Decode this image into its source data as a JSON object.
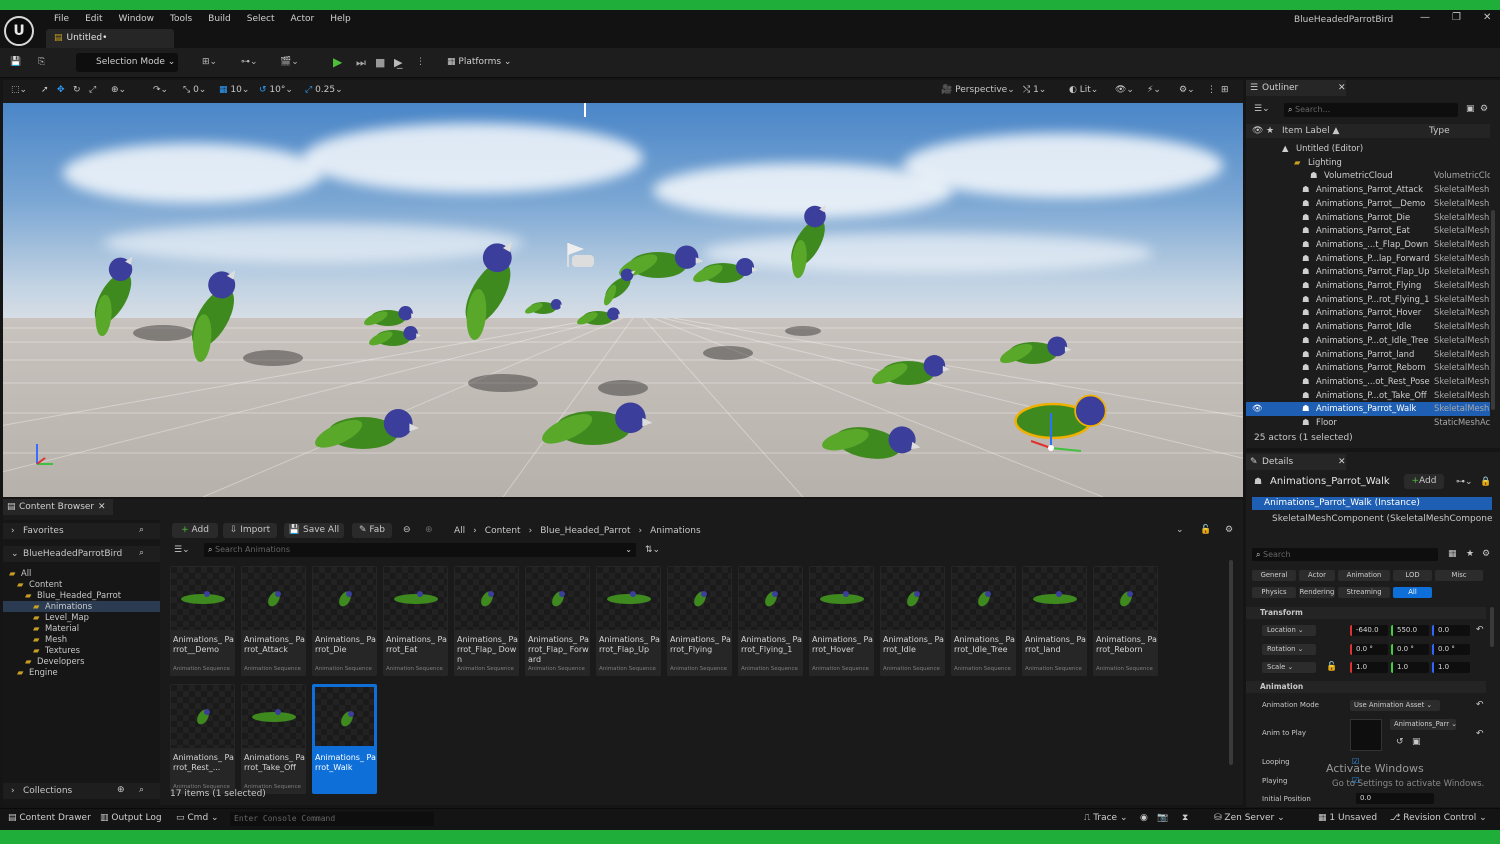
{
  "app": {
    "project_name": "BlueHeadedParrotBird",
    "doc_tab": "Untitled•",
    "logo": "U"
  },
  "menu": [
    "File",
    "Edit",
    "Window",
    "Tools",
    "Build",
    "Select",
    "Actor",
    "Help"
  ],
  "toolbar": {
    "selection_mode": "Selection Mode",
    "platforms": "Platforms"
  },
  "viewport_toolbar": {
    "grid_rot": "0",
    "snap_move": "10",
    "snap_rot": "10°",
    "snap_scale": "0.25",
    "view_mode": "Perspective",
    "view_count": "1",
    "lit": "Lit"
  },
  "outliner": {
    "title": "Outliner",
    "search_placeholder": "Search...",
    "col_label": "Item Label ▲",
    "col_type": "Type",
    "rows": [
      {
        "label": "Untitled (Editor)",
        "type": "",
        "indent": 50
      },
      {
        "label": "Lighting",
        "type": "",
        "indent": 62
      },
      {
        "label": "VolumetricCloud",
        "type": "VolumetricClo",
        "indent": 78
      },
      {
        "label": "Animations_Parrot_Attack",
        "type": "SkeletalMesh",
        "indent": 70
      },
      {
        "label": "Animations_Parrot__Demo",
        "type": "SkeletalMesh",
        "indent": 70
      },
      {
        "label": "Animations_Parrot_Die",
        "type": "SkeletalMesh",
        "indent": 70
      },
      {
        "label": "Animations_Parrot_Eat",
        "type": "SkeletalMesh",
        "indent": 70
      },
      {
        "label": "Animations_...t_Flap_Down",
        "type": "SkeletalMesh",
        "indent": 70
      },
      {
        "label": "Animations_P...lap_Forward",
        "type": "SkeletalMesh",
        "indent": 70
      },
      {
        "label": "Animations_Parrot_Flap_Up",
        "type": "SkeletalMesh",
        "indent": 70
      },
      {
        "label": "Animations_Parrot_Flying",
        "type": "SkeletalMesh",
        "indent": 70
      },
      {
        "label": "Animations_P...rot_Flying_1",
        "type": "SkeletalMesh",
        "indent": 70
      },
      {
        "label": "Animations_Parrot_Hover",
        "type": "SkeletalMesh",
        "indent": 70
      },
      {
        "label": "Animations_Parrot_Idle",
        "type": "SkeletalMesh",
        "indent": 70
      },
      {
        "label": "Animations_P...ot_Idle_Tree",
        "type": "SkeletalMesh",
        "indent": 70
      },
      {
        "label": "Animations_Parrot_land",
        "type": "SkeletalMesh",
        "indent": 70
      },
      {
        "label": "Animations_Parrot_Reborn",
        "type": "SkeletalMesh",
        "indent": 70
      },
      {
        "label": "Animations_...ot_Rest_Pose",
        "type": "SkeletalMesh",
        "indent": 70
      },
      {
        "label": "Animations_P...ot_Take_Off",
        "type": "SkeletalMesh",
        "indent": 70
      },
      {
        "label": "Animations_Parrot_Walk",
        "type": "SkeletalMesh",
        "indent": 70,
        "selected": true
      },
      {
        "label": "Floor",
        "type": "StaticMeshAc",
        "indent": 70
      }
    ],
    "footer": "25 actors (1 selected)"
  },
  "details": {
    "title": "Details",
    "actor_name": "Animations_Parrot_Walk",
    "add_label": "Add",
    "instance": "Animations_Parrot_Walk (Instance)",
    "component": "SkeletalMeshComponent (SkeletalMeshComponen",
    "search_placeholder": "Search",
    "filters_row1": [
      "General",
      "Actor",
      "Animation",
      "LOD",
      "Misc"
    ],
    "filters_row2": [
      "Physics",
      "Rendering",
      "Streaming",
      "All"
    ],
    "transform_label": "Transform",
    "location_label": "Location",
    "location": [
      "-640.0",
      "550.0",
      "0.0"
    ],
    "rotation_label": "Rotation",
    "rotation": [
      "0.0 °",
      "0.0 °",
      "0.0 °"
    ],
    "scale_label": "Scale",
    "scale": [
      "1.0",
      "1.0",
      "1.0"
    ],
    "animation_label": "Animation",
    "anim_mode_label": "Animation Mode",
    "anim_mode_value": "Use Animation Asset",
    "anim_to_play_label": "Anim to Play",
    "anim_to_play_value": "Animations_Parr",
    "looping_label": "Looping",
    "playing_label": "Playing",
    "initial_position_label": "Initial Position",
    "initial_position_value": "0.0",
    "watermark_title": "Activate Windows",
    "watermark_sub": "Go to Settings to activate Windows."
  },
  "content_browser": {
    "tab": "Content Browser",
    "favorites": "Favorites",
    "project_root": "BlueHeadedParrotBird",
    "tree": [
      {
        "label": "All",
        "level": 0
      },
      {
        "label": "Content",
        "level": 1
      },
      {
        "label": "Blue_Headed_Parrot",
        "level": 2
      },
      {
        "label": "Animations",
        "level": 3,
        "selected": true
      },
      {
        "label": "Level_Map",
        "level": 3
      },
      {
        "label": "Material",
        "level": 3
      },
      {
        "label": "Mesh",
        "level": 3
      },
      {
        "label": "Textures",
        "level": 3
      },
      {
        "label": "Developers",
        "level": 2
      },
      {
        "label": "Engine",
        "level": 1
      }
    ],
    "collections": "Collections",
    "add_label": "Add",
    "import_label": "Import",
    "save_all_label": "Save All",
    "fab_label": "Fab",
    "breadcrumb": [
      "All",
      "Content",
      "Blue_Headed_Parrot",
      "Animations"
    ],
    "search_placeholder": "Search Animations",
    "asset_kind": "Animation Sequence",
    "assets": [
      "Animations_ Parrot__Demo",
      "Animations_ Parrot_Attack",
      "Animations_ Parrot_Die",
      "Animations_ Parrot_Eat",
      "Animations_ Parrot_Flap_ Down",
      "Animations_ Parrot_Flap_ Forward",
      "Animations_ Parrot_Flap_Up",
      "Animations_ Parrot_Flying",
      "Animations_ Parrot_Flying_1",
      "Animations_ Parrot_Hover",
      "Animations_ Parrot_Idle",
      "Animations_ Parrot_Idle_Tree",
      "Animations_ Parrot_land",
      "Animations_ Parrot_Reborn",
      "Animations_ Parrot_Rest_...",
      "Animations_ Parrot_Take_Off",
      "Animations_ Parrot_Walk"
    ],
    "selected_asset": 16,
    "items_count": "17 items (1 selected)"
  },
  "statusbar": {
    "content_drawer": "Content Drawer",
    "output_log": "Output Log",
    "cmd": "Cmd",
    "console_placeholder": "Enter Console Command",
    "trace": "Trace",
    "zen_server": "Zen Server",
    "unsaved": "1 Unsaved",
    "revision_control": "Revision Control"
  },
  "colors": {
    "accent_green": "#1fae3a",
    "selection_blue": "#1e5fb4",
    "play_green": "#4fbf3a"
  }
}
